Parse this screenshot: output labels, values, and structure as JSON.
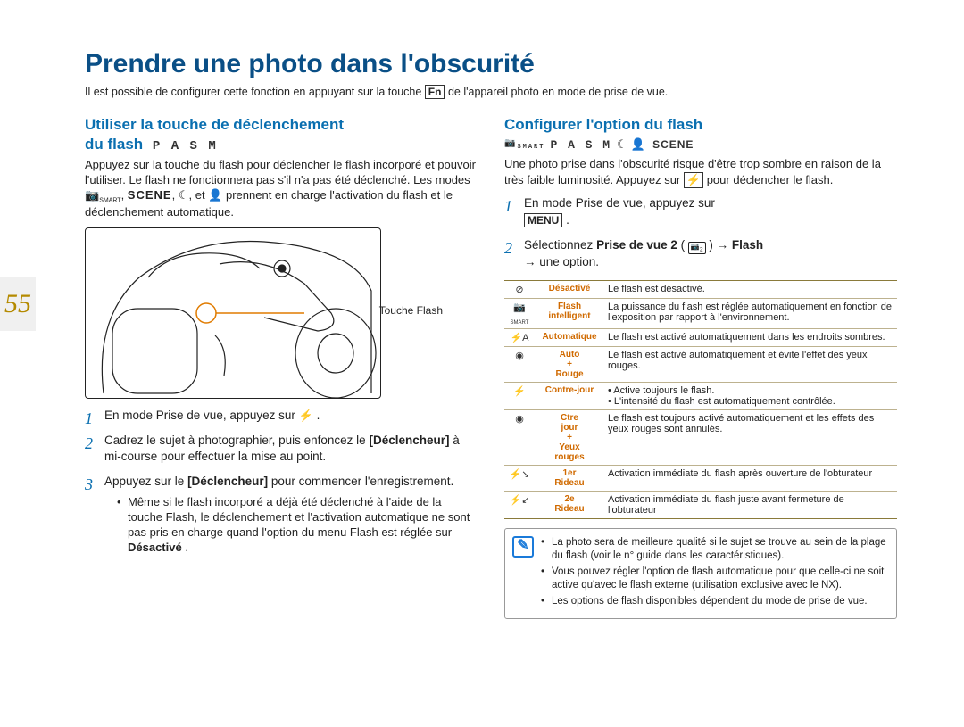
{
  "page_number": "55",
  "main_title": "Prendre une photo dans l'obscurité",
  "intro_before": "Il est possible de configurer cette fonction en appuyant sur la touche ",
  "intro_fn": "Fn",
  "intro_after": " de l'appareil photo en mode de prise de vue.",
  "left": {
    "title_l1": "Utiliser la touche de déclenchement",
    "title_l2": "du flash",
    "modes": "P A S M",
    "para1_a": "Appuyez sur la touche du flash pour déclencher le flash incorporé et pouvoir l'utiliser. Le flash ne fonctionnera pas s'il n'a pas été déclenché. Les modes ",
    "para1_b": ", ",
    "para1_c": ", et ",
    "para1_d": " prennent en charge l'activation du flash et le déclenchement automatique.",
    "scene_label": "SCENE",
    "diagram_label": "Touche Flash",
    "steps": [
      {
        "text_a": "En mode Prise de vue, appuyez sur ",
        "key": "",
        "text_b": "."
      },
      {
        "text_a": "Cadrez le sujet à photographier, puis enfoncez le ",
        "bold": "[Déclencheur]",
        "text_b": " à mi-course pour effectuer la mise au point."
      },
      {
        "text_a": "Appuyez sur le ",
        "bold": "[Déclencheur]",
        "text_b": " pour commencer l'enregistrement."
      }
    ],
    "bullet_a": "Même si le flash incorporé a déjà été déclenché à l'aide de la touche Flash, le déclenchement et l'activation automatique ne sont pas pris en charge quand l'option du menu Flash est réglée sur ",
    "bullet_bold": "Désactivé",
    "bullet_b": "."
  },
  "right": {
    "title": "Configurer l'option du flash",
    "mode_smart": "SMART",
    "modes": "P A S M",
    "mode_scene": "SCENE",
    "para_a": "Une photo prise dans l'obscurité risque d'être trop sombre en raison de la très faible luminosité. Appuyez sur ",
    "para_b": " pour déclencher le flash.",
    "step1_a": "En mode Prise de vue, appuyez sur ",
    "step1_key": "MENU",
    "step1_b": ".",
    "step2_a": "Sélectionnez ",
    "step2_bold1": "Prise de vue 2",
    "step2_mid": " (",
    "step2_icon_sub": "2",
    "step2_after_icon": ") → ",
    "step2_bold2": "Flash",
    "step2_b": " → une option.",
    "table": [
      {
        "icon": "⊘",
        "label": "Désactivé",
        "desc": "Le flash est désactivé."
      },
      {
        "icon": "SMART",
        "label": "Flash intelligent",
        "desc": "La puissance du flash est réglée automatiquement en fonction de l'exposition par rapport à l'environnement."
      },
      {
        "icon": "⚡A",
        "label": "Automatique",
        "desc": "Le flash est activé automatiquement dans les endroits sombres."
      },
      {
        "icon": "◉",
        "label": "Auto + Rouge",
        "desc": "Le flash est activé automatiquement et évite l'effet des yeux rouges."
      },
      {
        "icon": "⚡",
        "label": "Contre-jour",
        "desc": "• Active toujours le flash.\n• L'intensité du flash est automatiquement contrôlée."
      },
      {
        "icon": "◉",
        "label": "Ctre jour + Yeux rouges",
        "desc": "Le flash est toujours activé automatiquement et les effets des yeux rouges sont annulés."
      },
      {
        "icon": "⚡↘",
        "label": "1er Rideau",
        "desc": "Activation immédiate du flash après ouverture de l'obturateur"
      },
      {
        "icon": "⚡↙",
        "label": "2e Rideau",
        "desc": "Activation immédiate du flash juste avant fermeture de l'obturateur"
      }
    ],
    "notes": [
      "La photo sera de meilleure qualité si le sujet se trouve au sein de la plage du flash (voir le n° guide dans les caractéristiques).",
      "Vous pouvez régler l'option de flash automatique pour que celle-ci ne soit active qu'avec le flash externe (utilisation exclusive avec le NX).",
      "Les options de flash disponibles dépendent du mode de prise de vue."
    ]
  }
}
